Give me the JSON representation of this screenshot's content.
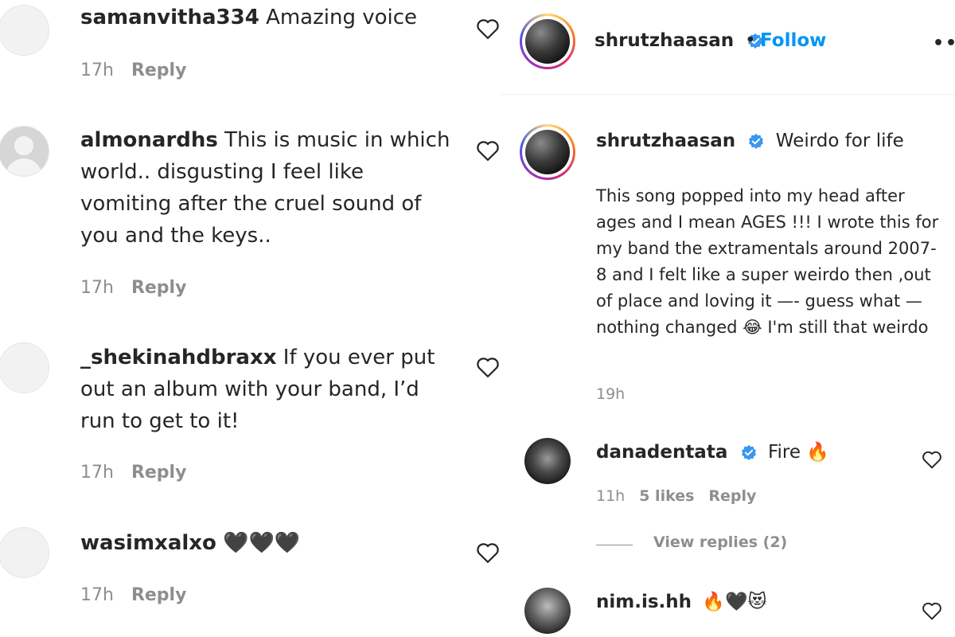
{
  "left_comments": [
    {
      "username": "samanvitha334",
      "text": "Amazing voice",
      "time": "17h",
      "reply": "Reply"
    },
    {
      "username": "almonardhs",
      "text": "This is music in which world.. disgusting I feel like vomiting after the cruel sound of you and the keys..",
      "time": "17h",
      "reply": "Reply"
    },
    {
      "username": "_shekinahdbraxx",
      "text": "If you ever put out an album with your band, I’d run to get to it!",
      "time": "17h",
      "reply": "Reply"
    },
    {
      "username": "wasimxalxo",
      "text": "🖤🖤🖤",
      "time": "17h",
      "reply": "Reply"
    }
  ],
  "post": {
    "username": "shrutzhaasan",
    "separator": "•",
    "follow_label": "Follow",
    "more_label": "•••",
    "caption_title": "Weirdo for life",
    "caption_body": "This song popped into my head after ages and I mean AGES !!! I wrote this for my band the extramentals around 2007-8 and I felt like a super weirdo then ,out of place and loving it —- guess what — nothing changed 😂 I'm still that weirdo",
    "time": "19h"
  },
  "right_comments": [
    {
      "username": "danadentata",
      "text": "Fire 🔥",
      "time": "11h",
      "likes": "5 likes",
      "reply": "Reply",
      "view_replies": "View replies (2)"
    },
    {
      "username": "nim.is.hh",
      "text": "🔥🖤😻"
    }
  ],
  "colors": {
    "accent": "#0095f6",
    "muted": "#8e8e8e",
    "text": "#262626"
  }
}
